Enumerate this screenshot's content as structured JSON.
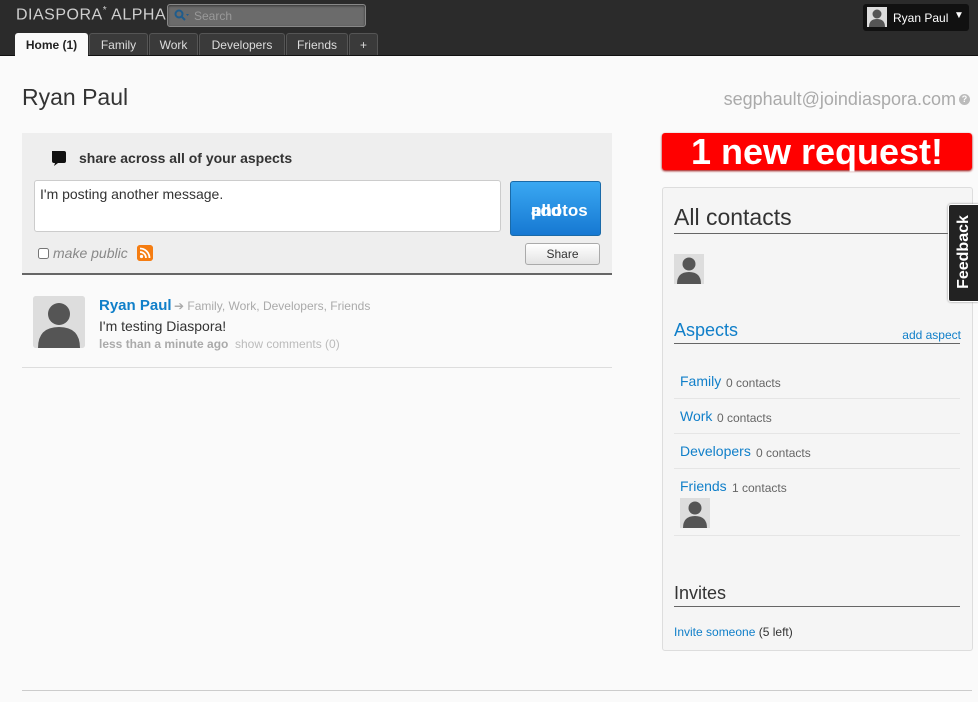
{
  "header": {
    "logo": "DIASPORA",
    "logo_sup": "*",
    "logo_suffix": " ALPHA",
    "search_placeholder": "Search",
    "user_name": "Ryan Paul",
    "user_menu_caret": "▼"
  },
  "tabs": [
    {
      "label": "Home (1)",
      "active": true
    },
    {
      "label": "Family"
    },
    {
      "label": "Work"
    },
    {
      "label": "Developers"
    },
    {
      "label": "Friends"
    },
    {
      "label": "+"
    }
  ],
  "page": {
    "title": "Ryan Paul",
    "handle": "segphault@joindiaspora.com",
    "help": "?"
  },
  "publisher": {
    "heading": "share across all of your aspects",
    "message": "I'm posting another message.",
    "add_photos_line1": "add",
    "add_photos_line2": "photos",
    "make_public": "make public",
    "share_label": "Share"
  },
  "stream": [
    {
      "author": "Ryan Paul",
      "aspects": "➔ Family, Work, Developers, Friends",
      "text": "I'm testing Diaspora!",
      "time": "less than a minute ago",
      "comments": "show comments (0)"
    }
  ],
  "sidebar": {
    "new_request": "1 new request!",
    "all_contacts_title": "All contacts",
    "aspects_title": "Aspects",
    "add_aspect": "add aspect",
    "aspects": [
      {
        "name": "Family",
        "count": "0 contacts"
      },
      {
        "name": "Work",
        "count": "0 contacts"
      },
      {
        "name": "Developers",
        "count": "0 contacts"
      },
      {
        "name": "Friends",
        "count": "1 contacts"
      }
    ],
    "invites_title": "Invites",
    "invite_link": "Invite someone",
    "invite_remaining": " (5 left)"
  },
  "feedback": "Feedback",
  "colors": {
    "link": "#107fc9",
    "header_bg": "#2b2b2b",
    "request_bg": "#ff0000",
    "add_photos_bg": "#1678d2"
  },
  "icons": [
    "search-icon",
    "speech-bubble-icon",
    "rss-icon",
    "help-icon",
    "avatar-silhouette-icon"
  ]
}
